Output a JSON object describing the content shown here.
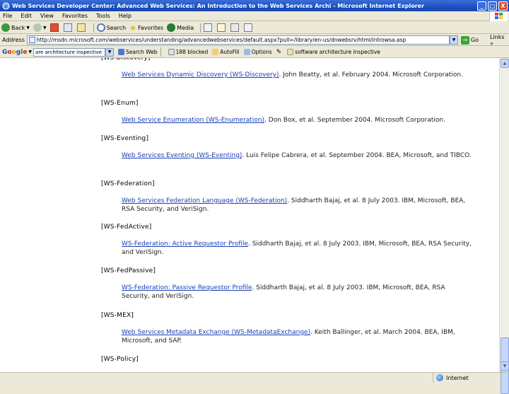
{
  "window": {
    "title": "Web Services Developer Center: Advanced Web Services: An Introduction to the Web Services Archi - Microsoft Internet Explorer",
    "minimize": "_",
    "maximize": "□",
    "close": "X"
  },
  "menu": [
    "File",
    "Edit",
    "View",
    "Favorites",
    "Tools",
    "Help"
  ],
  "toolbar": {
    "back": "Back",
    "search": "Search",
    "favorites": "Favorites",
    "media": "Media"
  },
  "address": {
    "label": "Address",
    "url": "http://msdn.microsoft.com/webservices/understanding/advancedwebservices/default.aspx?pull=/library/en-us/dnwebsrv/html/introwsa.asp",
    "go": "Go",
    "links": "Links »"
  },
  "googlebar": {
    "logo_parts": [
      "G",
      "o",
      "o",
      "g",
      "l",
      "e"
    ],
    "query": "are architecture inspective",
    "search_web": "Search Web",
    "blocked": "188 blocked",
    "autofill": "AutoFill",
    "options": "Options",
    "query_term": "software architecture inspective"
  },
  "entries": [
    {
      "tag": "",
      "link": "Web Services Dynamic Discovery (WS-Discovery)",
      "rest": ". John Beatty, et al. February 2004. Microsoft Corporation."
    },
    {
      "tag": "[WS-Enum]",
      "link": "Web Service Enumeration (WS-Enumeration)",
      "rest": ". Don Box, et al. September 2004. Microsoft Corporation."
    },
    {
      "tag": "[WS-Eventing]",
      "link": "Web Services Eventing (WS-Eventing)",
      "rest": ". Luis Felipe Cabrera, et al. September 2004. BEA, Microsoft, and TIBCO."
    },
    {
      "tag": "[WS-Federation]",
      "link": "Web Services Federation Language (WS-Federation)",
      "rest": ". Siddharth Bajaj, et al. 8 July 2003. IBM, Microsoft, BEA, RSA Security, and VeriSign."
    },
    {
      "tag": "[WS-FedActive]",
      "link": "WS-Federation: Active Requestor Profile",
      "rest": ". Siddharth Bajaj, et al. 8 July 2003. IBM, Microsoft, BEA, RSA Security, and VeriSign."
    },
    {
      "tag": "[WS-FedPassive]",
      "link": "WS-Federation: Passive Requestor Profile",
      "rest": ". Siddharth Bajaj, et al. 8 July 2003. IBM, Microsoft, BEA, RSA Security, and VeriSign."
    },
    {
      "tag": "[WS-MEX]",
      "link": "Web Services Metadata Exchange (WS-MetadataExchange)",
      "rest": ". Keith Ballinger, et al. March 2004. BEA, IBM, Microsoft, and SAP."
    },
    {
      "tag": "[WS-Policy]",
      "link": "",
      "rest": ""
    }
  ],
  "status": {
    "text": "",
    "zone": "Internet"
  },
  "colors": {
    "link": "#1a3fb4",
    "titlebar": "#1c4fc0"
  }
}
